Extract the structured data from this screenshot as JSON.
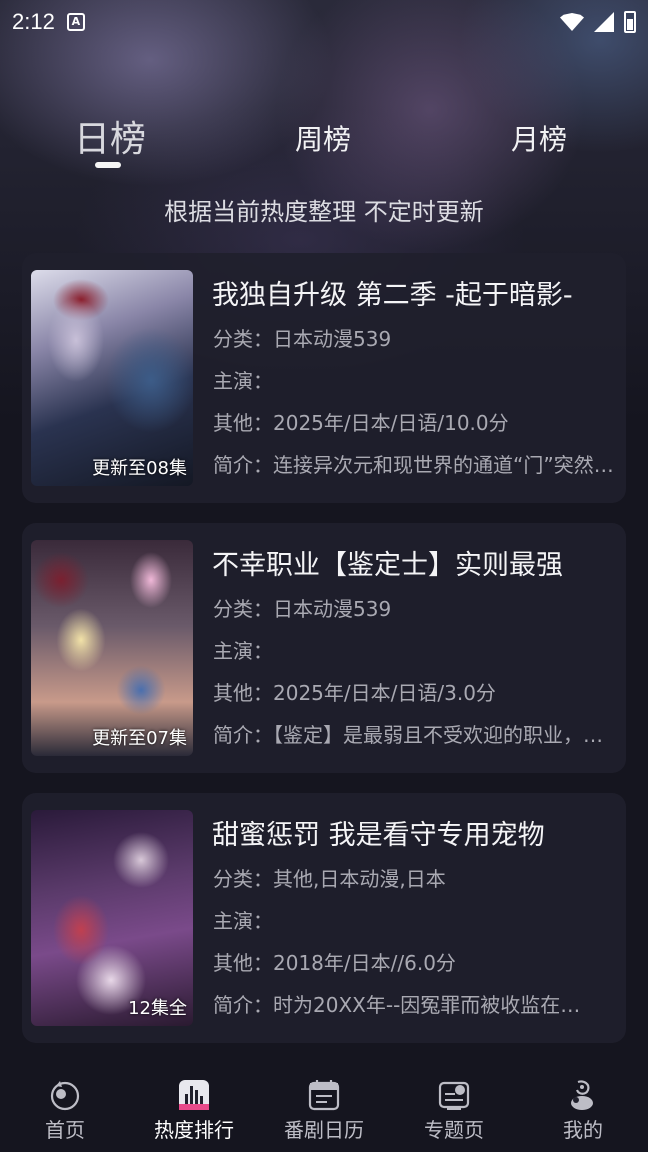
{
  "status": {
    "time": "2:12",
    "app_badge": "A"
  },
  "tabs": [
    {
      "label": "日榜"
    },
    {
      "label": "周榜"
    },
    {
      "label": "月榜"
    }
  ],
  "subtitle": "根据当前热度整理 不定时更新",
  "cards": [
    {
      "title": "我独自升级 第二季 -起于暗影-",
      "badge": "更新至08集",
      "category": "分类：日本动漫539",
      "cast": "主演：",
      "other": "其他：2025年/日本/日语/10.0分",
      "intro": "简介：连接异次元和现世界的通道“门”突然出现已经过去了十年"
    },
    {
      "title": "不幸职业【鉴定士】实则最强",
      "badge": "更新至07集",
      "category": "分类：日本动漫539",
      "cast": "主演：",
      "other": "其他：2025年/日本/日语/3.0分",
      "intro": "简介：【鉴定】是最弱且不受欢迎的职业，他却是最强的存在"
    },
    {
      "title": "甜蜜惩罚 我是看守专用宠物",
      "badge": "12集全",
      "category": "分类：其他,日本动漫,日本",
      "cast": "主演：",
      "other": "其他：2018年/日本//6.0分",
      "intro": "简介：时为20XX年--因冤罪而被收监在…"
    }
  ],
  "nav": [
    {
      "label": "首页",
      "icon": "home-icon"
    },
    {
      "label": "热度排行",
      "icon": "ranking-icon"
    },
    {
      "label": "番剧日历",
      "icon": "calendar-icon"
    },
    {
      "label": "专题页",
      "icon": "topic-icon"
    },
    {
      "label": "我的",
      "icon": "profile-icon"
    }
  ],
  "colors": {
    "background": "#15151f",
    "card": "#20202c",
    "active_tab": "#ffffff",
    "muted_text": "#a9a9b2"
  }
}
